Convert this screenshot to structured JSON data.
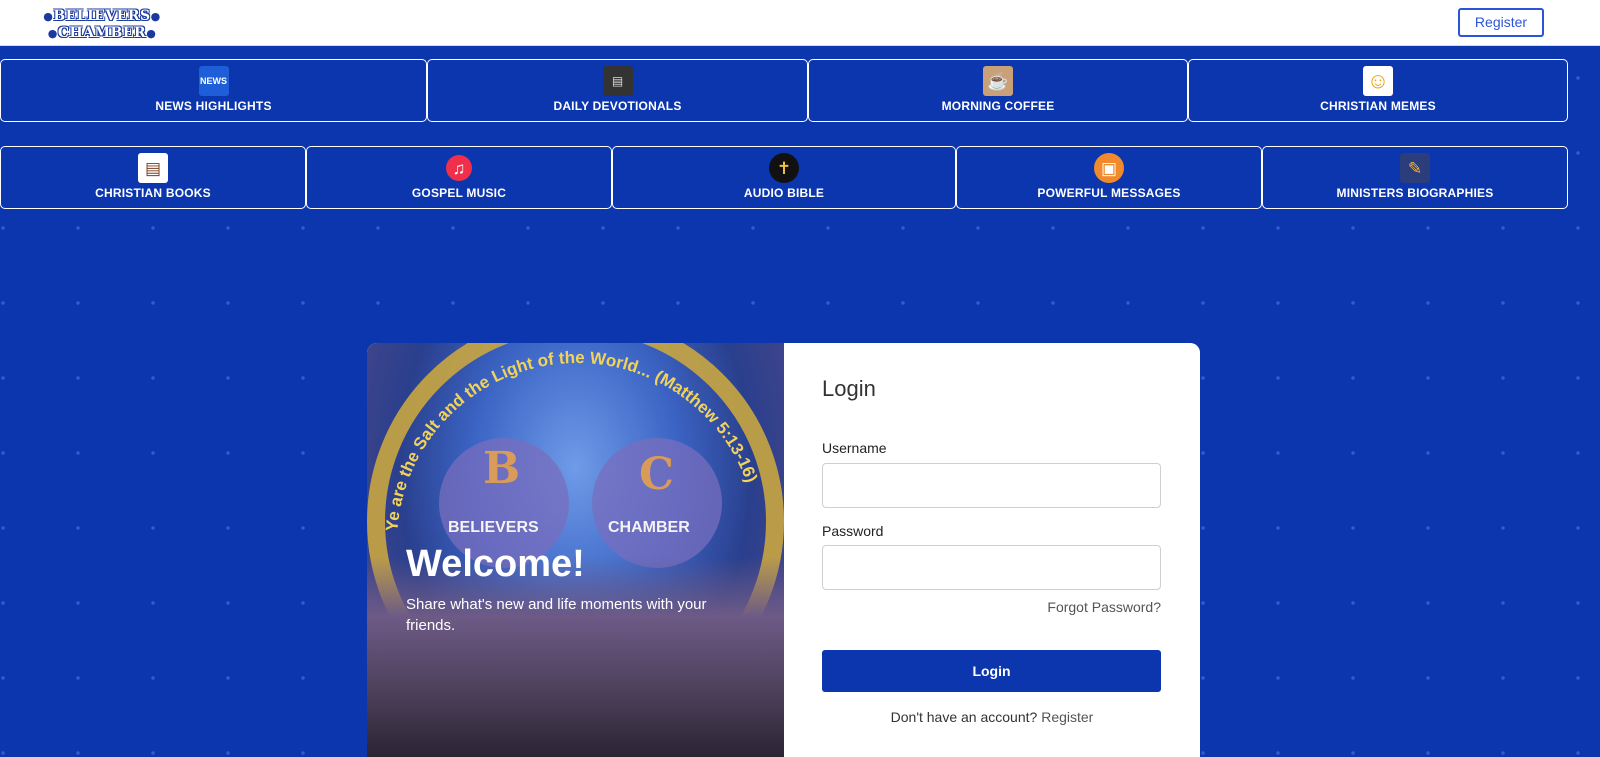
{
  "brand": {
    "logo_line1": "BELIEVERS",
    "logo_line2": "CHAMBER"
  },
  "header": {
    "register_label": "Register"
  },
  "categories_row1": [
    {
      "label": "NEWS HIGHLIGHTS",
      "icon": "breaking-news-icon"
    },
    {
      "label": "DAILY DEVOTIONALS",
      "icon": "devotional-book-icon"
    },
    {
      "label": "MORNING COFFEE",
      "icon": "coffee-cup-icon"
    },
    {
      "label": "CHRISTIAN MEMES",
      "icon": "laughing-emoji-icon"
    }
  ],
  "categories_row2": [
    {
      "label": "CHRISTIAN BOOKS",
      "icon": "books-stack-icon"
    },
    {
      "label": "GOSPEL MUSIC",
      "icon": "music-note-icon"
    },
    {
      "label": "AUDIO BIBLE",
      "icon": "headphones-bible-icon"
    },
    {
      "label": "POWERFUL MESSAGES",
      "icon": "pulpit-icon"
    },
    {
      "label": "MINISTERS BIOGRAPHIES",
      "icon": "notebook-pen-icon"
    }
  ],
  "hero": {
    "badge_left": "BELIEVERS",
    "badge_right": "CHAMBER",
    "badge_letter_left": "B",
    "badge_letter_right": "C",
    "arc_text": "Ye are the Salt and the Light of the World... (Matthew 5:13-16)",
    "welcome_title": "Welcome!",
    "welcome_subtitle": "Share what's new and life moments with your friends."
  },
  "login": {
    "title": "Login",
    "username_label": "Username",
    "username_value": "",
    "password_label": "Password",
    "password_value": "",
    "forgot_label": "Forgot Password?",
    "submit_label": "Login",
    "no_account_text": "Don't have an account?",
    "register_link": "Register"
  },
  "colors": {
    "background": "#0b36ae",
    "accent": "#2b55d8",
    "white": "#ffffff"
  }
}
